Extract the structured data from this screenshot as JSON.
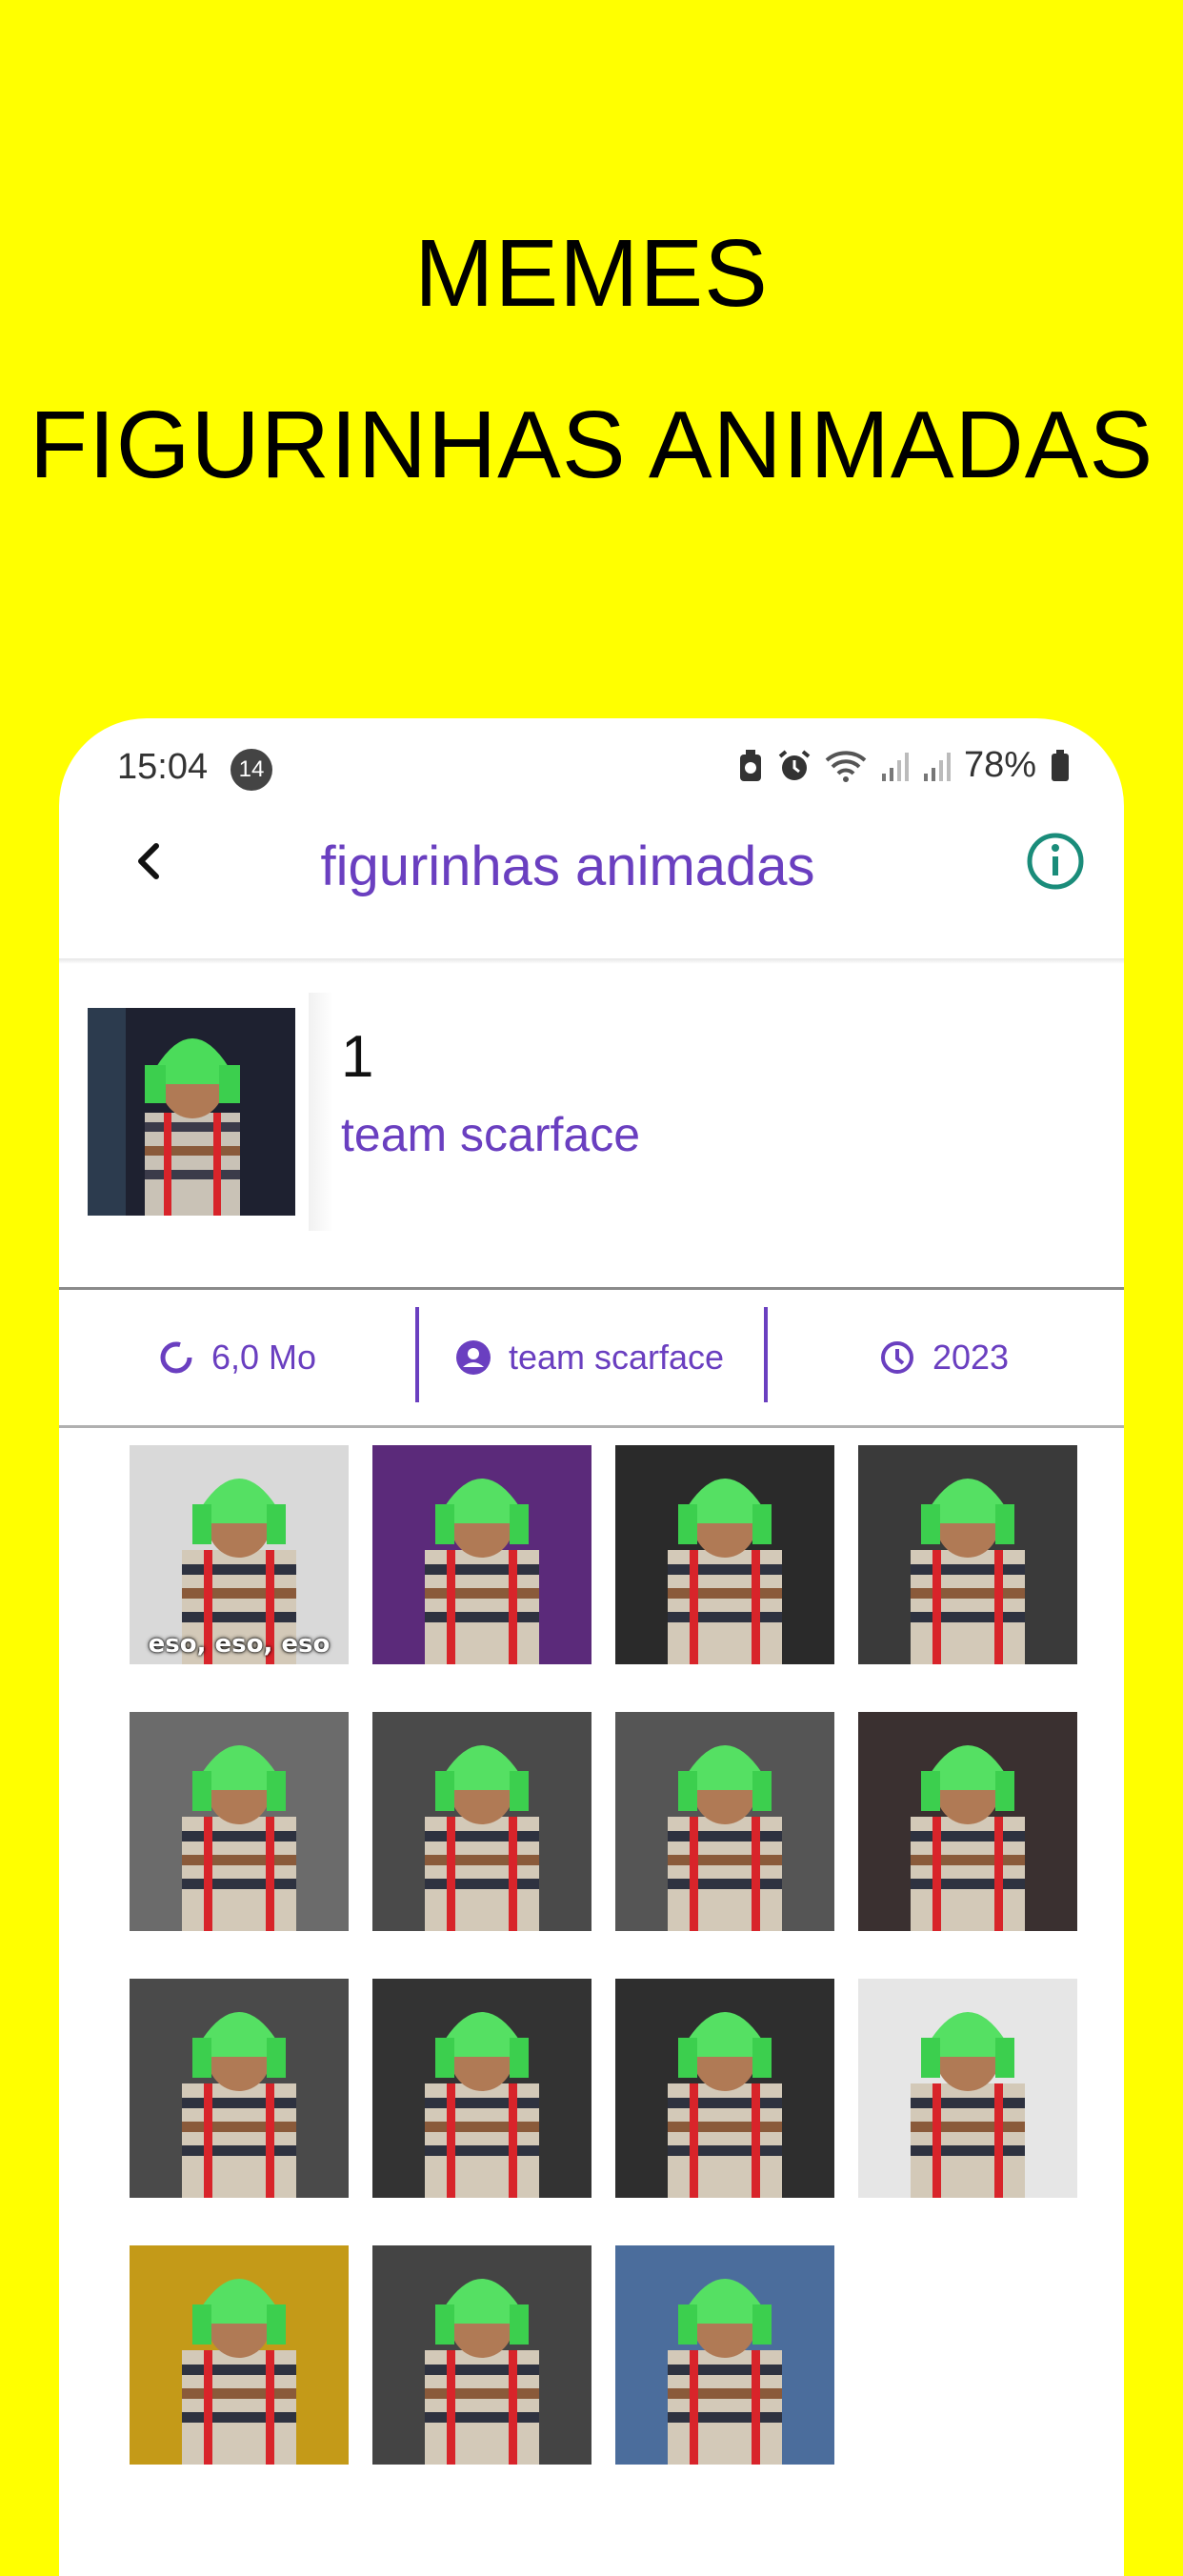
{
  "promo": {
    "line1": "MEMES",
    "line2": "FIGURINHAS ANIMADAS"
  },
  "statusbar": {
    "time": "15:04",
    "notification_count": "14",
    "battery": "78%"
  },
  "appbar": {
    "title": "figurinhas animadas"
  },
  "pack": {
    "number": "1",
    "author": "team scarface"
  },
  "infobar": {
    "size": "6,0 Mo",
    "author": "team scarface",
    "year": "2023"
  },
  "stickers": [
    {
      "caption": "eso, eso, eso"
    },
    {
      "caption": ""
    },
    {
      "caption": ""
    },
    {
      "caption": ""
    },
    {
      "caption": ""
    },
    {
      "caption": ""
    },
    {
      "caption": ""
    },
    {
      "caption": ""
    },
    {
      "caption": ""
    },
    {
      "caption": ""
    },
    {
      "caption": ""
    },
    {
      "caption": ""
    },
    {
      "caption": ""
    },
    {
      "caption": ""
    },
    {
      "caption": ""
    }
  ],
  "colors": {
    "background": "#FFFF00",
    "accent": "#6A3FC0",
    "info_icon": "#1A8C7A"
  }
}
